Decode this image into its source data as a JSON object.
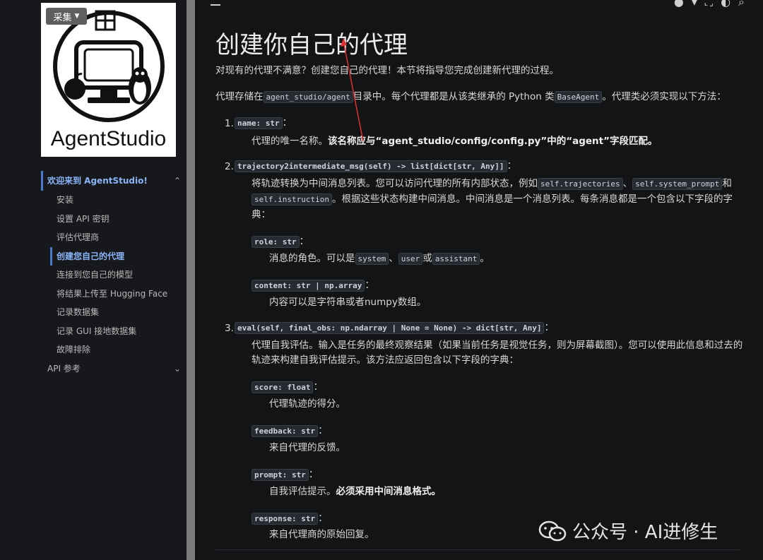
{
  "sidebar": {
    "collect_label": "采集",
    "logo_text": "AgentStudio",
    "nav_top": "欢迎来到 AgentStudio!",
    "items": [
      "安装",
      "设置 API 密钥",
      "评估代理商",
      "创建您自己的代理",
      "连接到您自己的模型",
      "将结果上传至 Hugging Face",
      "记录数据集",
      "记录 GUI 接地数据集",
      "故障排除"
    ],
    "api_label": "API 参考"
  },
  "main": {
    "title": "创建你自己的代理",
    "intro": "对现有的代理不满意？创建您自己的代理！本节将指导您完成创建新代理的过程。",
    "p2_a": "代理存储在",
    "p2_code1": "agent_studio/agent",
    "p2_b": "目录中。每个代理都是从该类继承的 Python 类",
    "p2_code2": "BaseAgent",
    "p2_c": "。代理类必须实现以下方法：",
    "m1_num": "1.",
    "m1_code": "name: str",
    "m1_desc_a": "代理的唯一名称。",
    "m1_desc_b": "该名称应与“agent_studio/config/config.py”中的“agent”字段匹配。",
    "m2_num": "2.",
    "m2_code": "trajectory2intermediate_msg(self) -> list[dict[str, Any]]",
    "m2_l1_a": "将轨迹转换为中间消息列表。您可以访问代理的所有内部状态，例如",
    "m2_l1_c1": "self.trajectories",
    "m2_l1_sep": "、",
    "m2_l1_c2": "self.system_prompt",
    "m2_l1_and": "和",
    "m2_l2_c": "self.instruction",
    "m2_l2_b": "。根据这些状态构建中间消息。中间消息是一个消息列表。每条消息都是一个包含以下字段的字",
    "m2_l3": "典：",
    "role_code": "role: str",
    "role_a": "消息的角色。可以是",
    "role_c1": "system",
    "role_sep": "、",
    "role_c2": "user",
    "role_or": "或",
    "role_c3": "assistant",
    "role_end": "。",
    "content_code": "content: str | np.array",
    "content_desc": "内容可以是字符串或者numpy数组。",
    "m3_num": "3.",
    "m3_code": "eval(self, final_obs: np.ndarray | None = None) -> dict[str, Any]",
    "m3_l1": "代理自我评估。输入是任务的最终观察结果（如果当前任务是视觉任务，则为屏幕截图）。您可以使用此信息和过去的",
    "m3_l2": "轨迹来构建自我评估提示。该方法应返回包含以下字段的字典：",
    "score_code": "score: float",
    "score_desc": "代理轨迹的得分。",
    "feedback_code": "feedback: str",
    "feedback_desc": "来自代理的反馈。",
    "prompt_code": "prompt: str",
    "prompt_desc_a": "自我评估提示。",
    "prompt_desc_b": "必须采用中间消息格式。",
    "response_code": "response: str",
    "response_desc": "来自代理商的原始回复。"
  },
  "colon": "：",
  "watermark": "公众号 · AI进修生"
}
